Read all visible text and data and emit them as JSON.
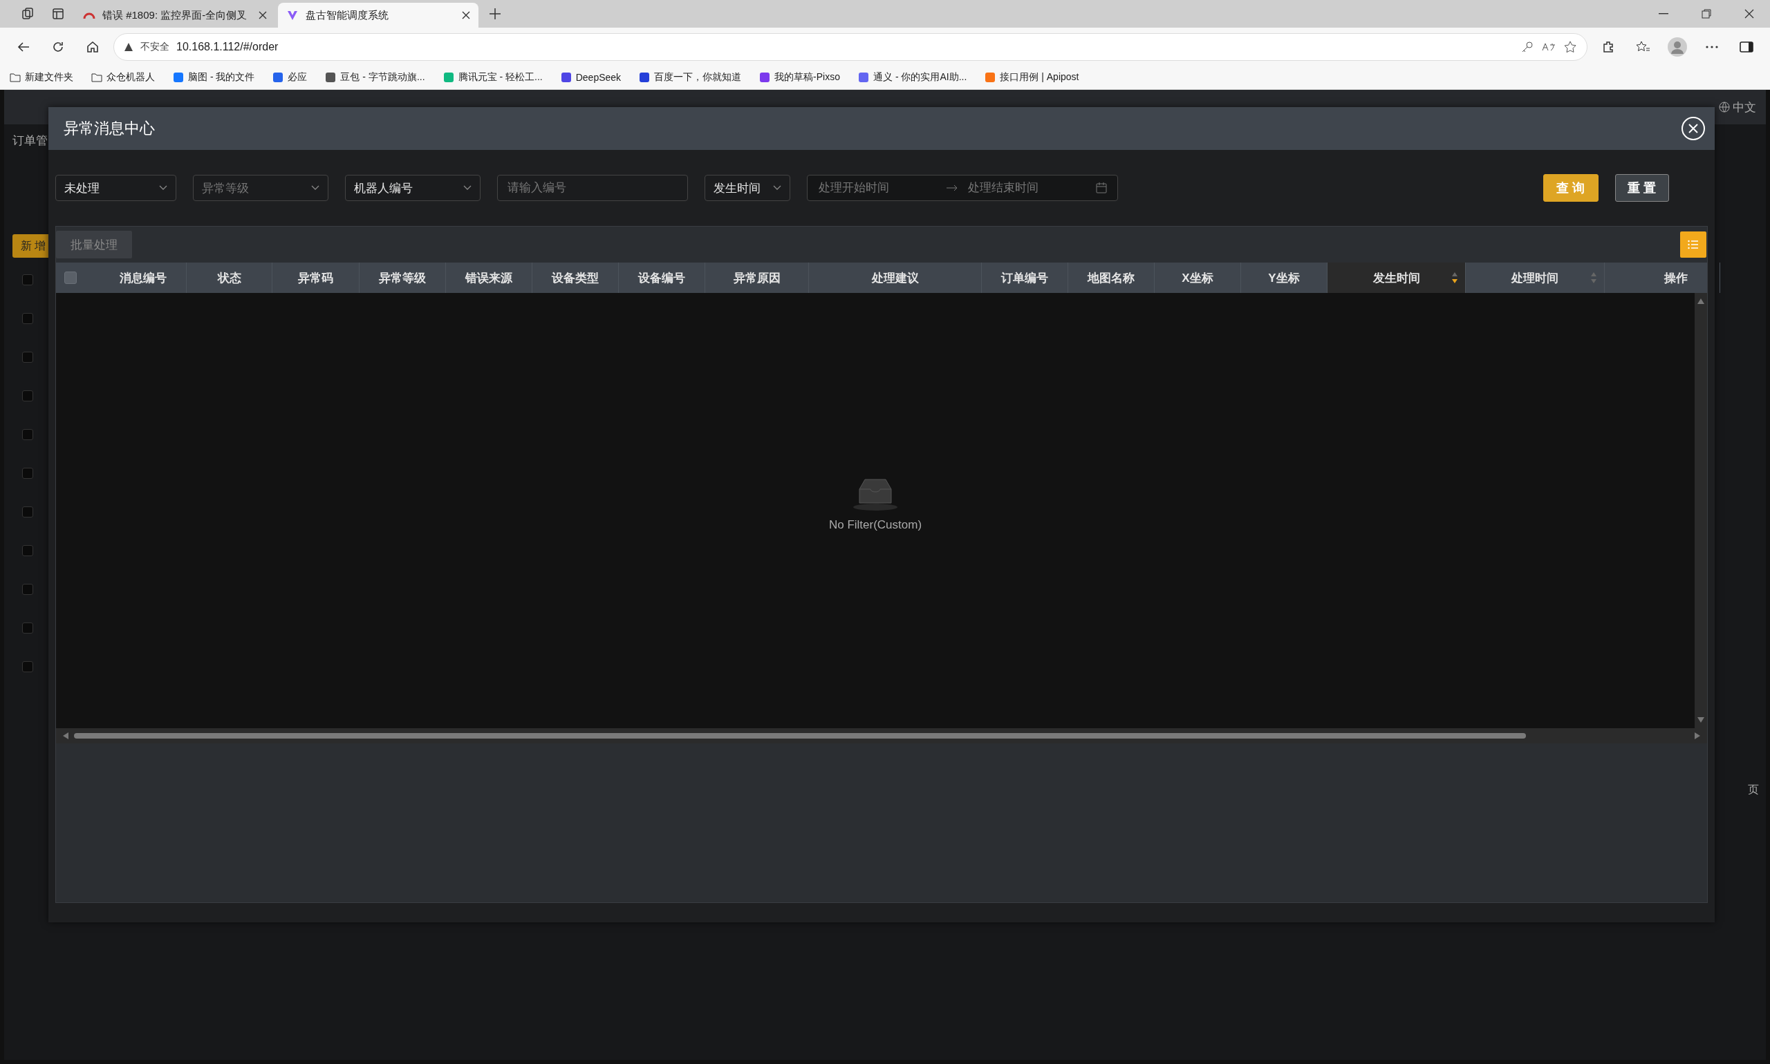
{
  "browser": {
    "tabs": [
      {
        "title": "错误 #1809: 监控界面-全向侧叉",
        "selected": false
      },
      {
        "title": "盘古智能调度系统",
        "selected": true
      }
    ],
    "address": {
      "security": "不安全",
      "url": "10.168.1.112/#/order"
    },
    "bookmarks": [
      "新建文件夹",
      "众仓机器人",
      "脑图 - 我的文件",
      "必应",
      "豆包 - 字节跳动旗...",
      "腾讯元宝 - 轻松工...",
      "DeepSeek",
      "百度一下，你就知道",
      "我的草稿-Pixso",
      "通义 - 你的实用AI助...",
      "接口用例 | Apipost"
    ]
  },
  "background_app": {
    "breadcrumb": "订单管",
    "add_button": "新 增",
    "language": "中文",
    "pager_fragment": "页",
    "row_checkboxes": [
      {
        "checked": false
      },
      {
        "checked": false
      },
      {
        "checked": false
      },
      {
        "checked": false
      },
      {
        "checked": false
      },
      {
        "checked": false
      },
      {
        "checked": false
      },
      {
        "checked": false
      },
      {
        "checked": false
      },
      {
        "checked": false
      },
      {
        "checked": false
      }
    ]
  },
  "modal": {
    "title": "异常消息中心",
    "filters": [
      {
        "kind": "select",
        "value": "未处理"
      },
      {
        "kind": "select",
        "placeholder": "异常等级"
      },
      {
        "kind": "select",
        "value": "机器人编号"
      },
      {
        "kind": "input",
        "placeholder": "请输入编号"
      },
      {
        "kind": "select",
        "value": "发生时间"
      },
      {
        "kind": "daterange",
        "start_placeholder": "处理开始时间",
        "end_placeholder": "处理结束时间"
      }
    ],
    "buttons": [
      {
        "kind": "primary",
        "label": "查 询"
      },
      {
        "kind": "default",
        "label": "重 置"
      }
    ],
    "batch_button": {
      "label": "批量处理",
      "disabled": true
    },
    "table": {
      "columns": [
        {
          "label": "消息编号"
        },
        {
          "label": "状态"
        },
        {
          "label": "异常码"
        },
        {
          "label": "异常等级"
        },
        {
          "label": "错误来源"
        },
        {
          "label": "设备类型"
        },
        {
          "label": "设备编号"
        },
        {
          "label": "异常原因"
        },
        {
          "label": "处理建议"
        },
        {
          "label": "订单编号"
        },
        {
          "label": "地图名称"
        },
        {
          "label": "X坐标"
        },
        {
          "label": "Y坐标"
        },
        {
          "label": "发生时间",
          "sortable": true,
          "sorted": true
        },
        {
          "label": "处理时间",
          "sortable": true,
          "sorted": false
        },
        {
          "label": "操作"
        }
      ],
      "select_all_checked": false,
      "empty_text": "No Filter(Custom)"
    }
  }
}
